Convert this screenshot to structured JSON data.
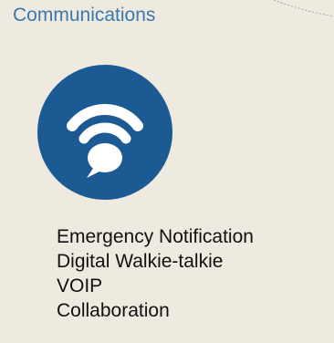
{
  "section": {
    "title": "Communications",
    "icon": "wifi-chat-bubble-icon",
    "icon_bg_color": "#1c5a94",
    "icon_fg_color": "#ffffff",
    "title_color": "#3a78ad"
  },
  "items": [
    {
      "label": "Emergency Notification"
    },
    {
      "label": "Digital Walkie-talkie"
    },
    {
      "label": "VOIP"
    },
    {
      "label": "Collaboration"
    }
  ],
  "colors": {
    "background": "#eeeadf"
  }
}
